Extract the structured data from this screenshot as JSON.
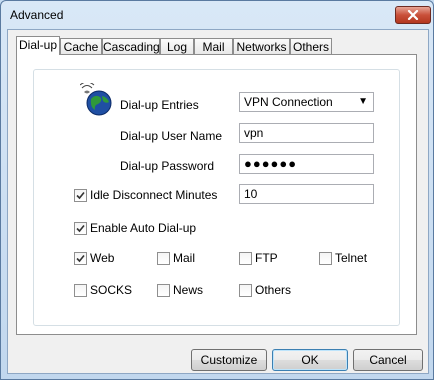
{
  "window": {
    "title": "Advanced"
  },
  "tabs": [
    {
      "label": "Dial-up",
      "active": true
    },
    {
      "label": "Cache",
      "active": false
    },
    {
      "label": "Cascading",
      "active": false
    },
    {
      "label": "Log",
      "active": false
    },
    {
      "label": "Mail",
      "active": false
    },
    {
      "label": "Networks",
      "active": false
    },
    {
      "label": "Others",
      "active": false
    }
  ],
  "dialup": {
    "entries_label": "Dial-up Entries",
    "entries_value": "VPN Connection",
    "username_label": "Dial-up User Name",
    "username_value": "vpn",
    "password_label": "Dial-up Password",
    "password_value": "●●●●●●",
    "idle_label": "Idle Disconnect Minutes",
    "idle_checked": true,
    "idle_value": "10",
    "auto_label": "Enable Auto Dial-up",
    "auto_checked": true
  },
  "protocols": [
    {
      "label": "Web",
      "checked": true
    },
    {
      "label": "Mail",
      "checked": false
    },
    {
      "label": "FTP",
      "checked": false
    },
    {
      "label": "Telnet",
      "checked": false
    },
    {
      "label": "SOCKS",
      "checked": false
    },
    {
      "label": "News",
      "checked": false
    },
    {
      "label": "Others",
      "checked": false
    }
  ],
  "buttons": {
    "customize": "Customize",
    "ok": "OK",
    "cancel": "Cancel"
  },
  "icons": {
    "close": "close-icon",
    "dialup": "globe-dialup-icon",
    "check": "checkmark-icon",
    "dropdown": "chevron-down-icon"
  }
}
